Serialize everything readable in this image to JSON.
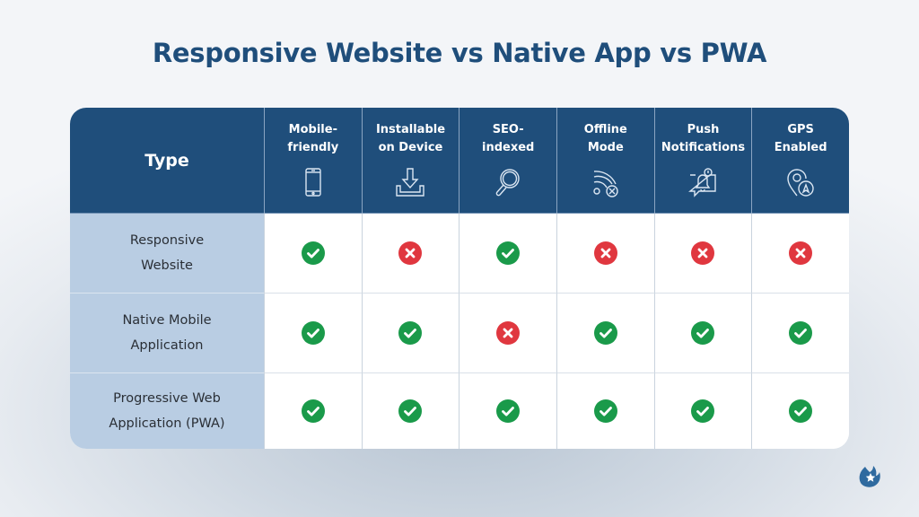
{
  "title": "Responsive Website vs Native App vs PWA",
  "table": {
    "type_header": "Type",
    "columns": [
      {
        "label": "Mobile-\nfriendly",
        "icon": "smartphone-icon"
      },
      {
        "label": "Installable\non Device",
        "icon": "download-icon"
      },
      {
        "label": "SEO-\nindexed",
        "icon": "magnifier-icon"
      },
      {
        "label": "Offline\nMode",
        "icon": "wifi-off-icon"
      },
      {
        "label": "Push\nNotifications",
        "icon": "notification-bell-icon"
      },
      {
        "label": "GPS\nEnabled",
        "icon": "location-pin-icon"
      }
    ],
    "rows": [
      {
        "label": "Responsive\nWebsite",
        "values": [
          true,
          false,
          true,
          false,
          false,
          false
        ]
      },
      {
        "label": "Native Mobile\nApplication",
        "values": [
          true,
          true,
          false,
          true,
          true,
          true
        ]
      },
      {
        "label": "Progressive Web\nApplication (PWA)",
        "values": [
          true,
          true,
          true,
          true,
          true,
          true
        ]
      }
    ]
  },
  "colors": {
    "header_bg": "#1f4e7b",
    "row_label_bg": "#b9cde3",
    "yes": "#1a9a4a",
    "no": "#e0373f"
  },
  "logo": "flame-star-logo-icon"
}
